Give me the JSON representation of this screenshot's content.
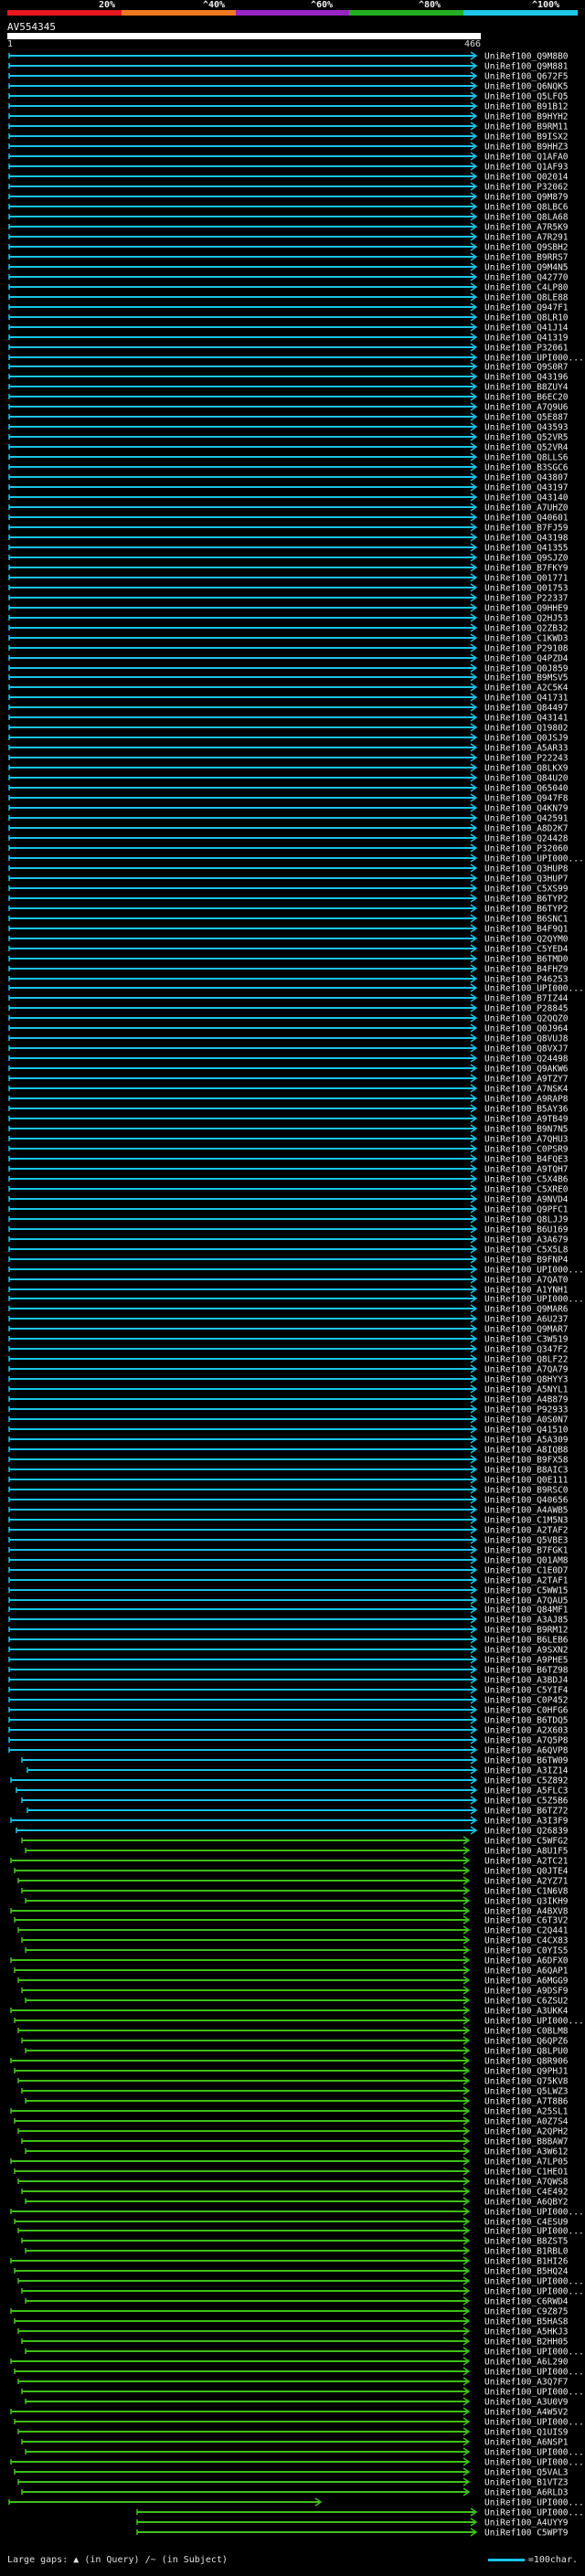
{
  "header": {
    "scale_labels": [
      "20%",
      "^40%",
      "^60%",
      "^80%",
      "^100%"
    ],
    "scale_colors": [
      "#e8171f",
      "#ee7820",
      "#9a24c2",
      "#22b022",
      "#1fc7e8"
    ]
  },
  "query": {
    "id": "AV554345",
    "start": "1",
    "end": "466"
  },
  "footer": {
    "large_gaps_label": "Large gaps:",
    "gap_query_desc": "(in Query)",
    "gap_subject_desc": "(in Subject)",
    "scale_label": "=100char."
  },
  "colors": {
    "cyan": "#19c3e6",
    "green": "#3ec018",
    "magenta": "#cc3fcc",
    "white": "#ffffff"
  },
  "hits": [
    "UniRef100_Q9M8B0",
    "UniRef100_Q9M881",
    "UniRef100_Q672F5",
    "UniRef100_Q6NQK5",
    "UniRef100_Q5LFQ5",
    "UniRef100_B91B12",
    "UniRef100_B9HYH2",
    "UniRef100_B9RM11",
    "UniRef100_B9ISX2",
    "UniRef100_B9HHZ3",
    "UniRef100_Q1AFA0",
    "UniRef100_Q1AF93",
    "UniRef100_Q02014",
    "UniRef100_P32062",
    "UniRef100_Q9M879",
    "UniRef100_Q8LBC6",
    "UniRef100_Q8LA68",
    "UniRef100_A7R5K9",
    "UniRef100_A7R291",
    "UniRef100_Q9SBH2",
    "UniRef100_B9RRS7",
    "UniRef100_Q9M4N5",
    "UniRef100_Q42770",
    "UniRef100_C4LP80",
    "UniRef100_Q8LE88",
    "UniRef100_Q947F1",
    "UniRef100_Q8LR10",
    "UniRef100_Q41J14",
    "UniRef100_Q41319",
    "UniRef100_P32061",
    "UniRef100_UPI000...",
    "UniRef100_Q9S0R7",
    "UniRef100_Q43196",
    "UniRef100_B8ZUY4",
    "UniRef100_B6EC20",
    "UniRef100_A7Q9U6",
    "UniRef100_Q5E887",
    "UniRef100_Q43593",
    "UniRef100_Q52VR5",
    "UniRef100_Q52VR4",
    "UniRef100_Q8LLS6",
    "UniRef100_B3SGC6",
    "UniRef100_Q43807",
    "UniRef100_Q43197",
    "UniRef100_Q43140",
    "UniRef100_A7UHZ0",
    "UniRef100_Q40601",
    "UniRef100_B7FJ59",
    "UniRef100_Q43198",
    "UniRef100_Q41355",
    "UniRef100_Q9SJZ0",
    "UniRef100_B7FKY9",
    "UniRef100_Q01771",
    "UniRef100_Q01753",
    "UniRef100_P22337",
    "UniRef100_Q9HHE9",
    "UniRef100_Q2HJ53",
    "UniRef100_Q2ZB32",
    "UniRef100_C1KWD3",
    "UniRef100_P29108",
    "UniRef100_Q4PZD4",
    "UniRef100_Q0J859",
    "UniRef100_B9MSV5",
    "UniRef100_A2C5K4",
    "UniRef100_Q41731",
    "UniRef100_Q84497",
    "UniRef100_Q43141",
    "UniRef100_Q19802",
    "UniRef100_Q0JSJ9",
    "UniRef100_A5AR33",
    "UniRef100_P22243",
    "UniRef100_Q8LKX9",
    "UniRef100_Q84U20",
    "UniRef100_Q65040",
    "UniRef100_Q947F8",
    "UniRef100_Q4KN79",
    "UniRef100_Q42591",
    "UniRef100_A8D2K7",
    "UniRef100_Q24428",
    "UniRef100_P32060",
    "UniRef100_UPI000...",
    "UniRef100_Q3HUP8",
    "UniRef100_Q3HUP7",
    "UniRef100_C5XS99",
    "UniRef100_B6TYP2",
    "UniRef100_B6TYP2",
    "UniRef100_B6SNC1",
    "UniRef100_B4F9Q1",
    "UniRef100_Q2QYM0",
    "UniRef100_C5YED4",
    "UniRef100_B6TMD0",
    "UniRef100_B4FHZ9",
    "UniRef100_P46253",
    "UniRef100_UPI000...",
    "UniRef100_B7IZ44",
    "UniRef100_P28845",
    "UniRef100_Q2QQZ0",
    "UniRef100_Q0J964",
    "UniRef100_Q8VUJ8",
    "UniRef100_Q8VXJ7",
    "UniRef100_Q24498",
    "UniRef100_Q9AKW6",
    "UniRef100_A9TZY7",
    "UniRef100_A7NSK4",
    "UniRef100_A9RAP8",
    "UniRef100_B5AY36",
    "UniRef100_A9TB49",
    "UniRef100_B9N7N5",
    "UniRef100_A7QHU3",
    "UniRef100_C0PSR9",
    "UniRef100_B4FQE3",
    "UniRef100_A9TQH7",
    "UniRef100_C5X4B6",
    "UniRef100_C5XRE0",
    "UniRef100_A9NVD4",
    "UniRef100_Q9PFC1",
    "UniRef100_Q8LJJ9",
    "UniRef100_B6U169",
    "UniRef100_A3A679",
    "UniRef100_C5X5L8",
    "UniRef100_B9FNP4",
    "UniRef100_UPI000...",
    "UniRef100_A7QAT0",
    "UniRef100_A1YNH1",
    "UniRef100_UPI000...",
    "UniRef100_Q9MAR6",
    "UniRef100_A6U237",
    "UniRef100_Q9MAR7",
    "UniRef100_C3W519",
    "UniRef100_Q347F2",
    "UniRef100_Q8LF22",
    "UniRef100_A7QA79",
    "UniRef100_Q8HYY3",
    "UniRef100_A5NYL1",
    "UniRef100_A4B879",
    "UniRef100_P92933",
    "UniRef100_A0S0N7",
    "UniRef100_Q41510",
    "UniRef100_A5A309",
    "UniRef100_A8IQB8",
    "UniRef100_B9FX58",
    "UniRef100_B8AIC3",
    "UniRef100_Q0E111",
    "UniRef100_B9RSC0",
    "UniRef100_Q40656",
    "UniRef100_A4AWB5",
    "UniRef100_C1M5N3",
    "UniRef100_A2TAF2",
    "UniRef100_Q5VBE3",
    "UniRef100_B7FGK1",
    "UniRef100_Q01AM8",
    "UniRef100_C1E0D7",
    "UniRef100_A2TAF1",
    "UniRef100_C5WW15",
    "UniRef100_A7QAU5",
    "UniRef100_Q84MF1",
    "UniRef100_A3AJ85",
    "UniRef100_B9RM12",
    "UniRef100_B6LEB6",
    "UniRef100_A9SXN2",
    "UniRef100_A9PHE5",
    "UniRef100_B6TZ98",
    "UniRef100_A3BDJ4",
    "UniRef100_C5YIF4",
    "UniRef100_C0P452",
    "UniRef100_C0HFG6",
    "UniRef100_B6TDQ5",
    "UniRef100_A2X603",
    "UniRef100_A7Q5P8",
    "UniRef100_A6QVP8",
    "UniRef100_B6TW09",
    "UniRef100_A3IZ14",
    "UniRef100_C5Z892",
    "UniRef100_A5FLC3",
    "UniRef100_C5Z5B6",
    "UniRef100_B6TZ72",
    "UniRef100_A3I3F9",
    "UniRef100_Q26839",
    "UniRef100_C5WFG2",
    "UniRef100_A8U1F5",
    "UniRef100_A2TC21",
    "UniRef100_Q0JTE4",
    "UniRef100_A2YZ71",
    "UniRef100_C1N6V8",
    "UniRef100_Q3IKH9",
    "UniRef100_A4BXV8",
    "UniRef100_C6T3V2",
    "UniRef100_C2Q441",
    "UniRef100_C4CX83",
    "UniRef100_C0YIS5",
    "UniRef100_A6DFX0",
    "UniRef100_A6QAP1",
    "UniRef100_A6MGG9",
    "UniRef100_A9DSF9",
    "UniRef100_C6ZSU2",
    "UniRef100_A3UKK4",
    "UniRef100_UPI000...",
    "UniRef100_C0BLM8",
    "UniRef100_Q6QPZ6",
    "UniRef100_Q8LPU0",
    "UniRef100_Q8R906",
    "UniRef100_Q9PHJ1",
    "UniRef100_Q75KV8",
    "UniRef100_Q5LWZ3",
    "UniRef100_A7T8B6",
    "UniRef100_A25SL1",
    "UniRef100_A0Z7S4",
    "UniRef100_A2QPH2",
    "UniRef100_B8BAW7",
    "UniRef100_A3W612",
    "UniRef100_A7LP05",
    "UniRef100_C1HEO1",
    "UniRef100_A7QWS8",
    "UniRef100_C4E492",
    "UniRef100_A6QBY2",
    "UniRef100_UPI000...",
    "UniRef100_C4ESU9",
    "UniRef100_UPI000...",
    "UniRef100_B8ZST5",
    "UniRef100_B1RBL0",
    "UniRef100_B1HI26",
    "UniRef100_B5HQ24",
    "UniRef100_UPI000...",
    "UniRef100_UPI000...",
    "UniRef100_C6RWD4",
    "UniRef100_C9Z875",
    "UniRef100_B5HAS8",
    "UniRef100_A5HKJ3",
    "UniRef100_B2HH05",
    "UniRef100_UPI000...",
    "UniRef100_A6L290",
    "UniRef100_UPI000...",
    "UniRef100_A3Q7F7",
    "UniRef100_UPI000...",
    "UniRef100_A3U0V9",
    "UniRef100_A4W5V2",
    "UniRef100_UPI000...",
    "UniRef100_Q1UIS9",
    "UniRef100_A6NSP1",
    "UniRef100_UPI000...",
    "UniRef100_UPI000...",
    "UniRef100_Q5VAL3",
    "UniRef100_B1VTZ3",
    "UniRef100_A6RLD3",
    "UniRef100_UPI000...",
    "UniRef100_UPI000...",
    "UniRef100_A4UYY9",
    "UniRef100_C5WPT9"
  ]
}
